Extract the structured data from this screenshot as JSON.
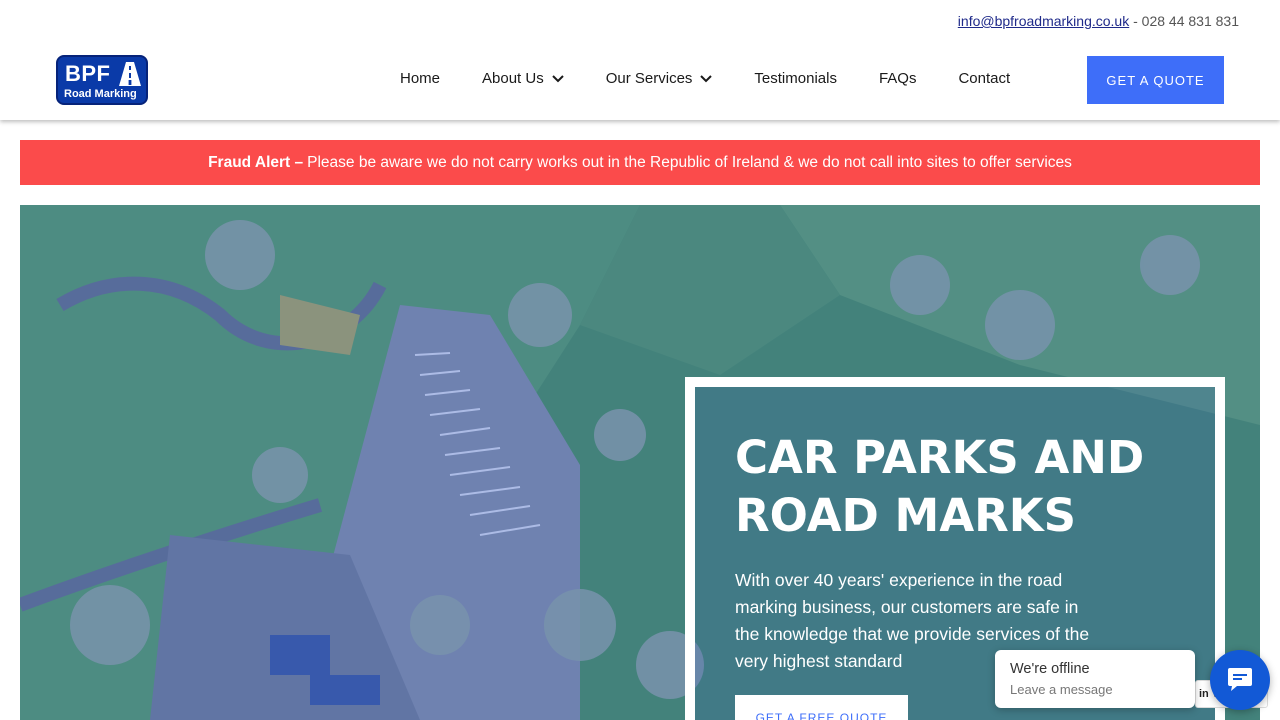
{
  "header": {
    "email": "info@bpfroadmarking.co.uk",
    "phone_sep": " - ",
    "phone": "028 44 831 831",
    "logo": {
      "text_top": "BPF",
      "text_bottom": "Road Marking"
    },
    "nav": [
      {
        "label": "Home",
        "has_dropdown": false
      },
      {
        "label": "About Us",
        "has_dropdown": true
      },
      {
        "label": "Our Services",
        "has_dropdown": true
      },
      {
        "label": "Testimonials",
        "has_dropdown": false
      },
      {
        "label": "FAQs",
        "has_dropdown": false
      },
      {
        "label": "Contact",
        "has_dropdown": false
      }
    ],
    "quote_button": "GET A QUOTE"
  },
  "alert": {
    "label": "Fraud Alert –",
    "message": "Please be aware we do not carry works out in the Republic of Ireland & we do not call into sites to offer services"
  },
  "hero": {
    "title": "CAR PARKS AND ROAD MARKS",
    "subtitle": "With over 40 years' experience in the road marking business, our customers are safe in the knowledge that we provide services of the very highest standard",
    "button": "GET A FREE QUOTE"
  },
  "chat": {
    "status": "We're offline",
    "sub": "Leave a message",
    "peek": "in V"
  },
  "colors": {
    "accent": "#3e6ef9",
    "alert": "#fb4b4b",
    "logo": "#0a3aa8",
    "chat": "#1259d6"
  }
}
